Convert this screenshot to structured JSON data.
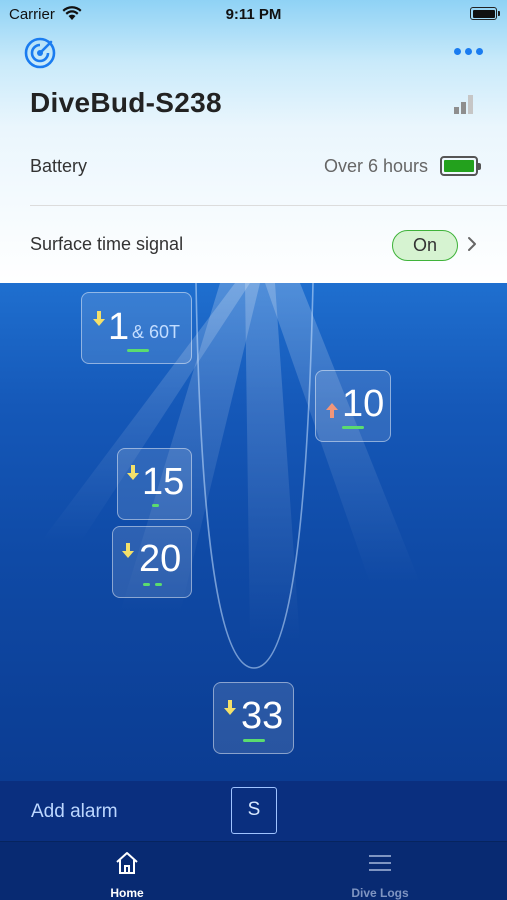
{
  "status_bar": {
    "carrier": "Carrier",
    "time": "9:11 PM"
  },
  "header": {
    "device_name": "DiveBud-S238"
  },
  "battery": {
    "label": "Battery",
    "value": "Over 6 hours",
    "color": "#23a11d"
  },
  "surface_signal": {
    "label": "Surface time signal",
    "state": "On"
  },
  "depth_markers": [
    {
      "value": "1",
      "extra": "& 60T",
      "direction": "down"
    },
    {
      "value": "10",
      "direction": "up"
    },
    {
      "value": "15",
      "direction": "down"
    },
    {
      "value": "20",
      "direction": "down"
    },
    {
      "value": "33",
      "direction": "down"
    }
  ],
  "alarm": {
    "label": "Add alarm",
    "button": "S"
  },
  "tabs": [
    {
      "label": "Home",
      "icon": "home-icon",
      "active": true
    },
    {
      "label": "Dive Logs",
      "icon": "list-icon",
      "active": false
    }
  ],
  "colors": {
    "accent": "#1a7cf0",
    "ocean": "#1558b8",
    "marker_dash": "#5bdc6e",
    "pill_border": "#3fb33a"
  }
}
